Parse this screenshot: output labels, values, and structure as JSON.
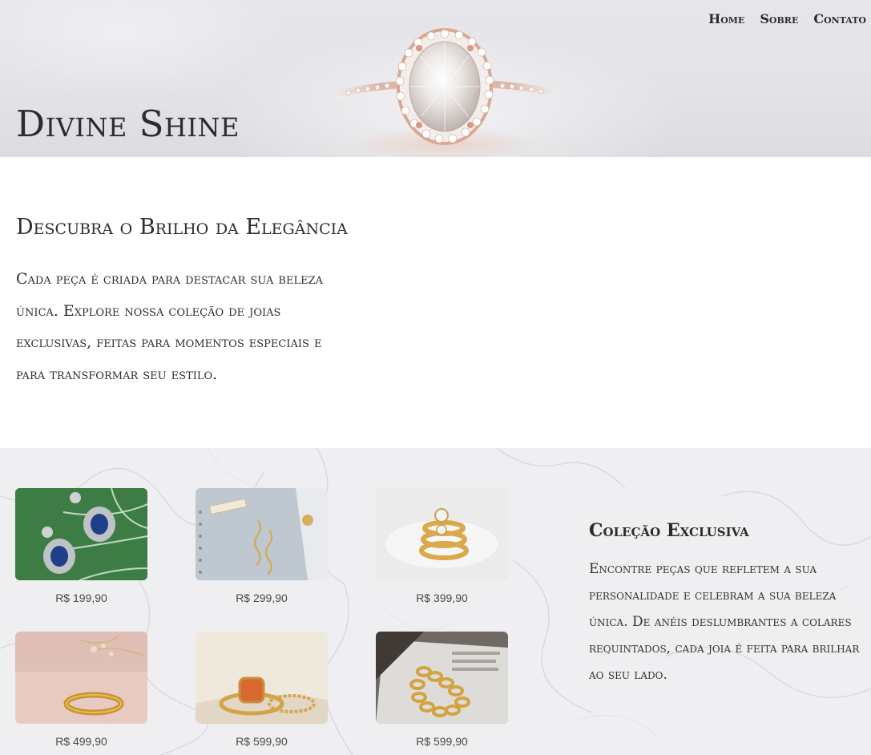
{
  "header": {
    "site_title": "Divine Shine",
    "nav": [
      "Home",
      "Sobre",
      "Contato"
    ]
  },
  "intro": {
    "heading": "Descubra o Brilho da Elegância",
    "text": "Cada peça é criada para destacar sua beleza única. Explore nossa coleção de joias exclusivas, feitas para momentos especiais e para transformar seu estilo."
  },
  "collection": {
    "products": [
      {
        "image": "sapphire-earrings-on-leaf",
        "price": "R$ 199,90"
      },
      {
        "image": "gold-drop-earrings-notebook",
        "price": "R$ 299,90"
      },
      {
        "image": "stacked-gold-diamond-rings",
        "price": "R$ 399,90"
      },
      {
        "image": "engraved-gold-ring-pink",
        "price": "R$ 499,90"
      },
      {
        "image": "orange-stone-gold-rings",
        "price": "R$ 599,90"
      },
      {
        "image": "gold-chain-bracelet-magazine",
        "price": "R$ 599,90"
      }
    ],
    "heading": "Coleção Exclusiva",
    "text": "Encontre peças que refletem a sua personalidade e celebram a sua beleza única. De anéis deslumbrantes a colares requintados, cada joia é feita para brilhar ao seu lado."
  },
  "colors": {
    "text": "#2b2b2b",
    "hero_bg": "#e6e6e9",
    "collection_bg": "#eeeef0"
  }
}
